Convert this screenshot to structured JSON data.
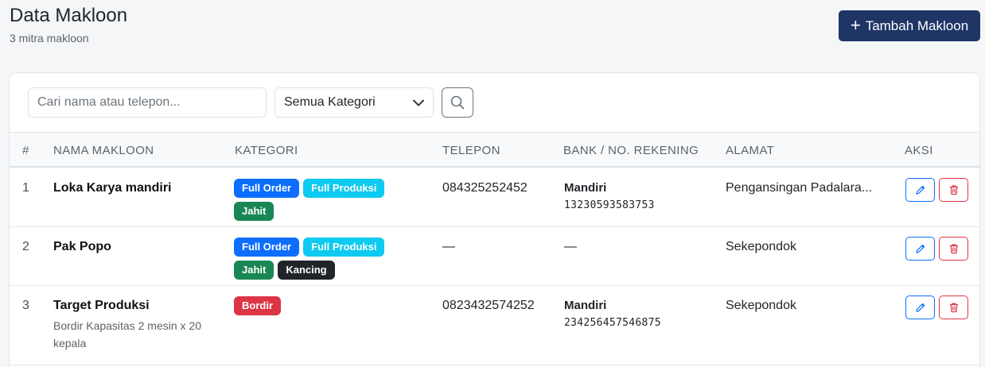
{
  "header": {
    "title": "Data Makloon",
    "subtitle": "3 mitra makloon",
    "add_label": "Tambah Makloon"
  },
  "filters": {
    "search_placeholder": "Cari nama atau telepon...",
    "category_selected": "Semua Kategori"
  },
  "columns": [
    "#",
    "NAMA MAKLOON",
    "KATEGORI",
    "TELEPON",
    "BANK / NO. REKENING",
    "ALAMAT",
    "AKSI"
  ],
  "badge_colors": {
    "Full Order": "#0d6efd",
    "Full Produksi": "#0dcaf0",
    "Jahit": "#198754",
    "Kancing": "#212529",
    "Bordir": "#dc3545"
  },
  "rows": [
    {
      "num": "1",
      "name": "Loka Karya mandiri",
      "note": "",
      "categories": [
        "Full Order",
        "Full Produksi",
        "Jahit"
      ],
      "phone": "084325252452",
      "bank": "Mandiri",
      "account": "13230593583753",
      "address": "Pengansingan Padalara..."
    },
    {
      "num": "2",
      "name": "Pak Popo",
      "note": "",
      "categories": [
        "Full Order",
        "Full Produksi",
        "Jahit",
        "Kancing"
      ],
      "phone": "—",
      "bank": "—",
      "account": "",
      "address": "Sekepondok"
    },
    {
      "num": "3",
      "name": "Target Produksi",
      "note": "Bordir Kapasitas 2 mesin x 20 kepala",
      "categories": [
        "Bordir"
      ],
      "phone": "0823432574252",
      "bank": "Mandiri",
      "account": "234256457546875",
      "address": "Sekepondok"
    }
  ],
  "icons": {
    "add": "plus-icon",
    "search": "search-icon",
    "dropdown": "chevron-down-icon",
    "edit": "pencil-icon",
    "delete": "trash-icon"
  }
}
